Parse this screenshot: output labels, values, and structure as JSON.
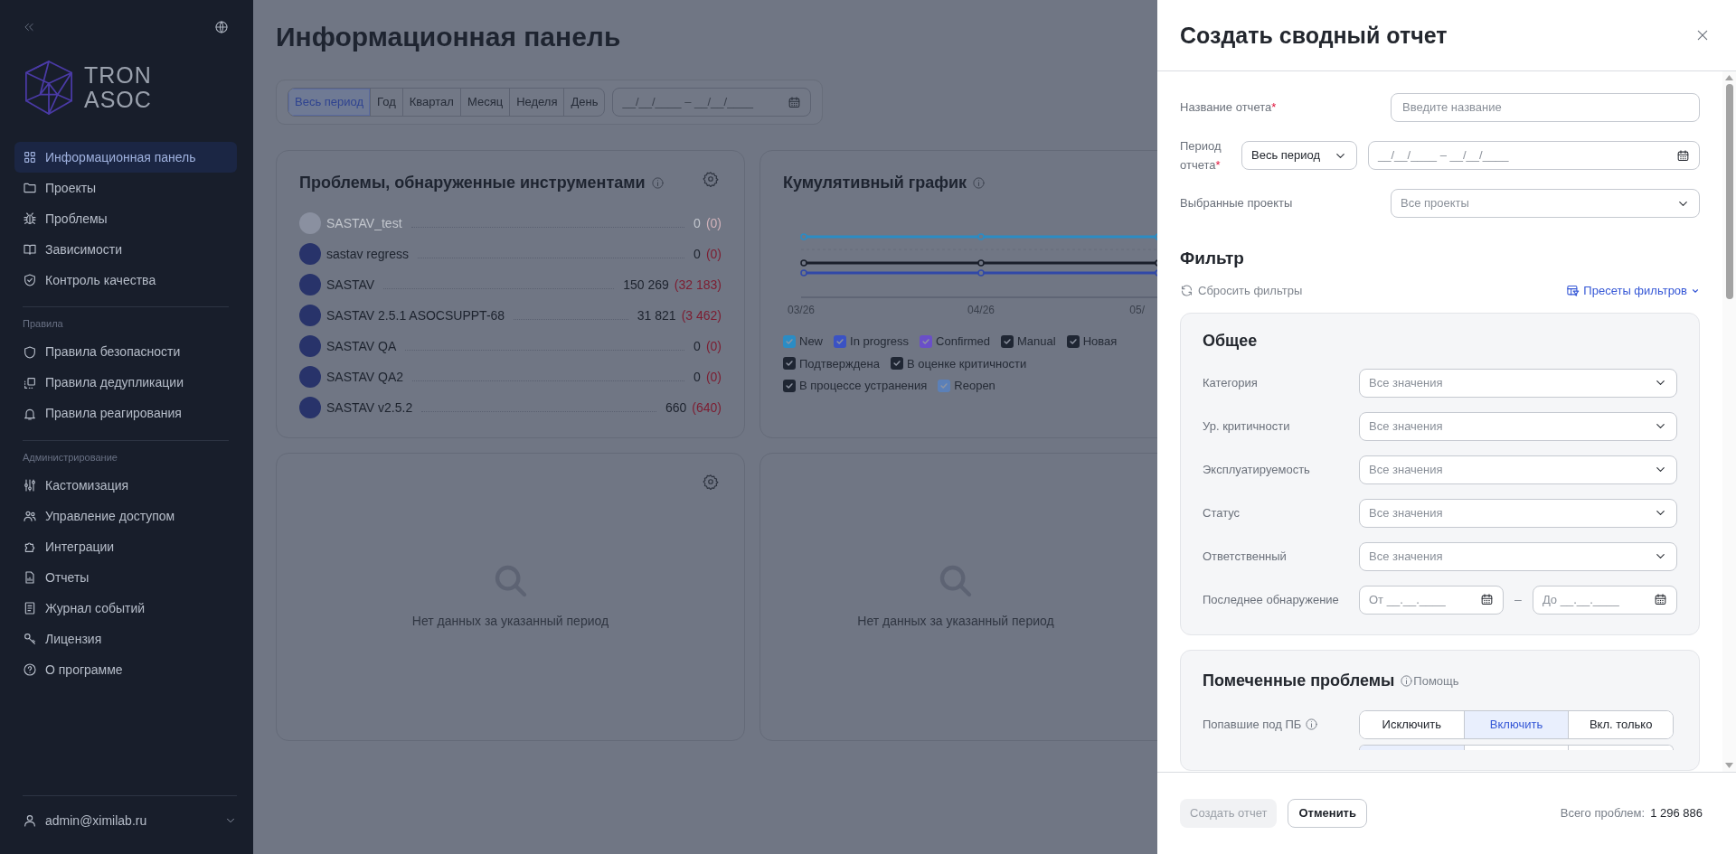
{
  "sidebar": {
    "logo_lines": [
      "TRON",
      "ASOC"
    ],
    "sections": [
      {
        "items": [
          {
            "label": "Информационная панель",
            "selected": true
          },
          {
            "label": "Проекты",
            "selected": false
          },
          {
            "label": "Проблемы",
            "selected": false
          },
          {
            "label": "Зависимости",
            "selected": false
          },
          {
            "label": "Контроль качества",
            "selected": false
          }
        ]
      },
      {
        "heading": "Правила",
        "items": [
          {
            "label": "Правила безопасности",
            "selected": false
          },
          {
            "label": "Правила дедупликации",
            "selected": false
          },
          {
            "label": "Правила реагирования",
            "selected": false
          }
        ]
      },
      {
        "heading": "Администрирование",
        "items": [
          {
            "label": "Кастомизация",
            "selected": false
          },
          {
            "label": "Управление доступом",
            "selected": false
          },
          {
            "label": "Интеграции",
            "selected": false
          },
          {
            "label": "Отчеты",
            "selected": false
          },
          {
            "label": "Журнал событий",
            "selected": false
          },
          {
            "label": "Лицензия",
            "selected": false
          },
          {
            "label": "О программе",
            "selected": false
          }
        ]
      }
    ],
    "user": "admin@ximilab.ru"
  },
  "dashboard": {
    "title": "Информационная панель",
    "period_tabs": [
      {
        "label": "Весь период",
        "selected": true
      },
      {
        "label": "Год",
        "selected": false
      },
      {
        "label": "Квартал",
        "selected": false
      },
      {
        "label": "Месяц",
        "selected": false
      },
      {
        "label": "Неделя",
        "selected": false
      },
      {
        "label": "День",
        "selected": false
      }
    ],
    "date_range": {
      "placeholder": "__/__/____ – __/__/____"
    },
    "tools_card": {
      "title": "Проблемы, обнаруженные инструментами",
      "rows": [
        {
          "name": "SASTAV_test",
          "total": "0",
          "new": "(0)",
          "disabled": true
        },
        {
          "name": "sastav regress",
          "total": "0",
          "new": "(0)",
          "disabled": false
        },
        {
          "name": "SASTAV",
          "total": "150 269",
          "new": "(32 183)",
          "disabled": false
        },
        {
          "name": "SASTAV 2.5.1 ASOCSUPPT-68",
          "total": "31 821",
          "new": "(3 462)",
          "disabled": false
        },
        {
          "name": "SASTAV QA",
          "total": "0",
          "new": "(0)",
          "disabled": false
        },
        {
          "name": "SASTAV QA2",
          "total": "0",
          "new": "(0)",
          "disabled": false
        },
        {
          "name": "SASTAV v2.5.2",
          "total": "660",
          "new": "(640)",
          "disabled": false
        }
      ]
    },
    "chart_card": {
      "title": "Кумулятивный график",
      "x_labels": [
        "03/26",
        "04/26",
        "05/"
      ],
      "legend": [
        {
          "label": "New",
          "color": "#2b8cc4",
          "checked": true
        },
        {
          "label": "In progress",
          "color": "#3a52c4",
          "checked": true
        },
        {
          "label": "Confirmed",
          "color": "#6a4fc8",
          "checked": true
        },
        {
          "label": "Manual",
          "color": "#1f2633",
          "checked": true
        },
        {
          "label": "Новая",
          "color": "#1f2633",
          "checked": true
        },
        {
          "label": "Подтверждена",
          "color": "#1f2633",
          "checked": true
        },
        {
          "label": "В оценке критичности",
          "color": "#1f2633",
          "checked": true
        },
        {
          "label": "В процессе устранения",
          "color": "#1f2633",
          "checked": true
        },
        {
          "label": "Reopen",
          "color": "#5b80b8",
          "checked": true
        }
      ]
    },
    "empty_cards": [
      {
        "message": "Нет данных за указанный период",
        "settings": true
      },
      {
        "message": "Нет данных за указанный период"
      }
    ]
  },
  "drawer": {
    "title": "Создать сводный отчет",
    "fields": [
      {
        "kind": "text",
        "label": "Название отчета",
        "mark": "*",
        "placeholder": "Введите название"
      },
      {
        "kind": "period",
        "label": "Период отчета",
        "mark": "*",
        "value": "Весь период",
        "placeholder": "__/__/____ – __/__/____"
      },
      {
        "kind": "select",
        "label": "Выбранные проекты",
        "placeholder": "Все проекты"
      }
    ],
    "filter": {
      "title": "Фильтр",
      "reset": "Сбросить фильтры",
      "presets": "Пресеты фильтров",
      "general": {
        "title": "Общее",
        "rows": [
          {
            "kind": "select",
            "label": "Категория",
            "placeholder": "Все значения"
          },
          {
            "kind": "select",
            "label": "Ур. критичности",
            "placeholder": "Все значения"
          },
          {
            "kind": "select",
            "label": "Эксплуатируемость",
            "placeholder": "Все значения"
          },
          {
            "kind": "select",
            "label": "Статус",
            "placeholder": "Все значения"
          },
          {
            "kind": "select",
            "label": "Ответственный",
            "placeholder": "Все значения"
          },
          {
            "kind": "date_range",
            "label": "Последнее обнаружение",
            "from": "От __.__.____",
            "separator": "–",
            "to": "До __.__.____"
          }
        ]
      },
      "marked": {
        "title": "Помеченные проблемы",
        "help": "Помощь",
        "rows": [
          {
            "label": "Попавшие под ПБ",
            "options": [
              {
                "label": "Исключить",
                "selected": false
              },
              {
                "label": "Включить",
                "selected": true
              },
              {
                "label": "Вкл. только",
                "selected": false
              }
            ]
          },
          {
            "options": [
              {
                "selected": true
              },
              {
                "selected": false
              },
              {
                "selected": false
              }
            ]
          }
        ]
      }
    },
    "footer": {
      "create": {
        "label": "Создать отчет",
        "disabled": true
      },
      "cancel": "Отменить",
      "total_label": "Всего проблем:",
      "total": "1 296 886"
    }
  }
}
